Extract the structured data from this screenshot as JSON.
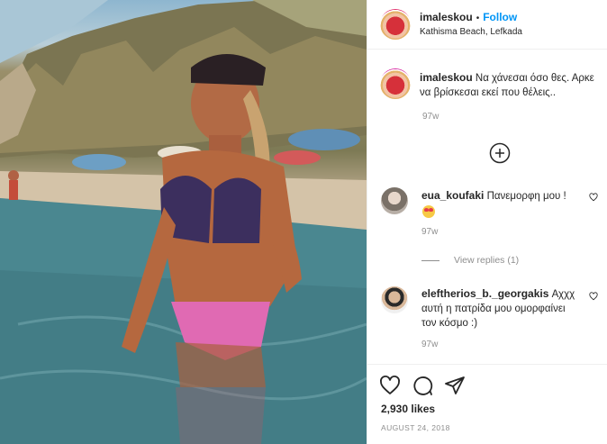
{
  "header": {
    "username": "imaleskou",
    "separator": "•",
    "follow_label": "Follow",
    "location": "Kathisma Beach, Lefkada",
    "avatar_icon": "profile-avatar"
  },
  "caption": {
    "username": "imaleskou",
    "line1": "Να χάνεσαι όσο θες. Αρκε",
    "line2": "να βρίσκεσαι εκεί που θέλεις..",
    "age": "97w"
  },
  "load_more_icon": "plus-circle-icon",
  "comments": [
    {
      "username": "eua_koufaki",
      "text": "Πανεμορφη μου !",
      "emoji": "heart-eyes-emoji",
      "age": "97w",
      "view_replies": "View replies (1)"
    },
    {
      "username": "eleftherios_b._georgakis",
      "text_line1": "Αχχχ",
      "text_line2": "αυτή η πατρίδα μου ομορφαίνει",
      "text_line3": "τον κόσμο :)",
      "age": "97w"
    }
  ],
  "actions": {
    "like_icon": "heart-icon",
    "comment_icon": "comment-icon",
    "share_icon": "paper-plane-icon"
  },
  "likes": "2,930 likes",
  "date": "AUGUST 24, 2018",
  "colors": {
    "accent": "#0095f6",
    "text": "#262626",
    "muted": "#8e8e8e",
    "border": "#efefef"
  }
}
